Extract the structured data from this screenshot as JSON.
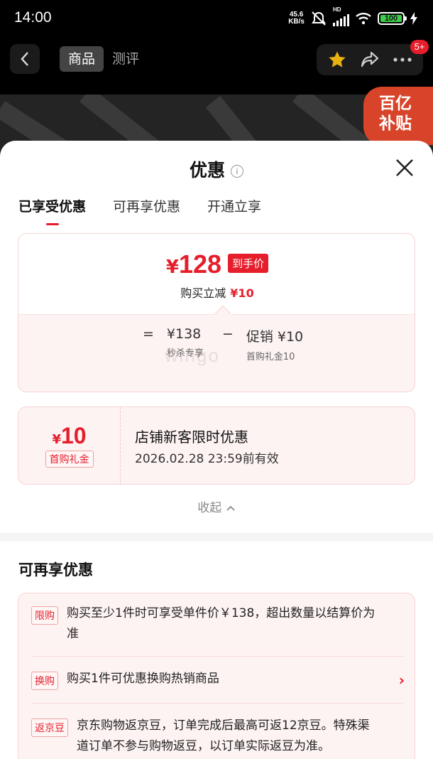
{
  "status": {
    "time": "14:00",
    "speed_value": "45.6",
    "speed_unit": "KB/s",
    "hd": "HD",
    "battery": "100"
  },
  "nav": {
    "tabs": [
      "商品",
      "测评"
    ],
    "badge": "5+"
  },
  "hero": {
    "subsidy_line1": "百亿",
    "subsidy_line2": "补贴"
  },
  "sheet": {
    "title": "优惠",
    "segments": [
      "已享受优惠",
      "可再享优惠",
      "开通立享"
    ],
    "price": {
      "currency": "¥",
      "amount": "128",
      "tag": "到手价",
      "sub_label": "购买立减",
      "sub_value": "¥10"
    },
    "calc": {
      "eq": "=",
      "minus": "−",
      "base_value": "¥138",
      "base_label": "秒杀专享",
      "promo_value": "促销 ¥10",
      "promo_label": "首购礼金10"
    },
    "watermark": "wingo",
    "coupon": {
      "currency": "¥",
      "amount": "10",
      "label": "首购礼金",
      "title": "店铺新客限时优惠",
      "expiry": "2026.02.28 23:59前有效"
    },
    "collapse": "收起",
    "more_title": "可再享优惠",
    "more": [
      {
        "tag": "限购",
        "text1": "购买至少1件时可享受单件价￥138，超出数量以结算价为",
        "text2": "准"
      },
      {
        "tag": "换购",
        "text1": "购买1件可优惠换购热销商品",
        "text2": ""
      },
      {
        "tag": "返京豆",
        "text1": "京东购物返京豆，订单完成后最高可返12京豆。特殊渠",
        "text2": "道订单不参与购物返豆，以订单实际返豆为准。"
      }
    ]
  },
  "colors": {
    "accent": "#e61e2b",
    "card_bg": "#fef3f3",
    "card_border": "#f7d3d3"
  }
}
